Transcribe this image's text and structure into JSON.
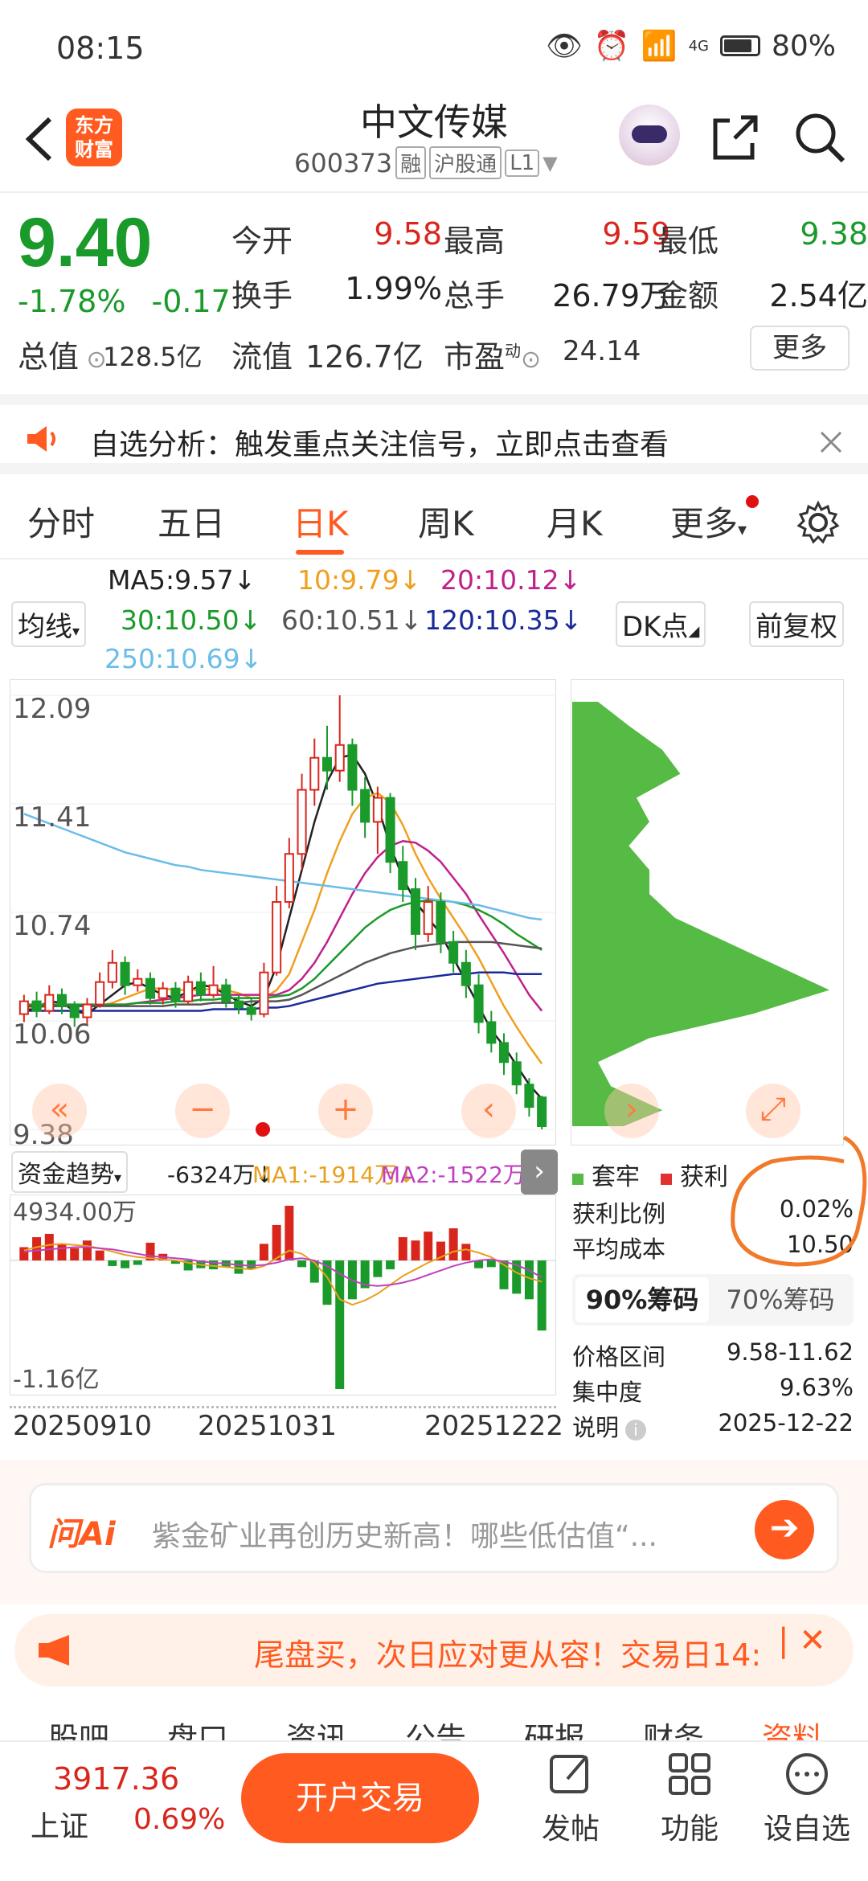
{
  "status": {
    "time": "08:15",
    "network": "4G",
    "battery": "80%"
  },
  "header": {
    "logo": "东方财富",
    "name": "中文传媒",
    "code": "600373",
    "tags": [
      "融",
      "沪股通",
      "L1"
    ]
  },
  "quote": {
    "price": "9.40",
    "change_pct": "-1.78%",
    "change": "-0.17",
    "rows": [
      [
        {
          "label": "今开",
          "value": "9.58",
          "color": "red"
        },
        {
          "label": "最高",
          "value": "9.59",
          "color": "red"
        },
        {
          "label": "最低",
          "value": "9.38",
          "color": "green"
        }
      ],
      [
        {
          "label": "换手",
          "value": "1.99%",
          "color": "dark"
        },
        {
          "label": "总手",
          "value": "26.79万",
          "color": "dark"
        },
        {
          "label": "金额",
          "value": "2.54亿",
          "color": "dark"
        }
      ]
    ],
    "total_value_label": "总值",
    "total_value": "128.5亿",
    "float_label": "流值",
    "float_value": "126.7亿",
    "pe_label": "市盈",
    "pe_sup": "动",
    "pe_value": "24.14",
    "more": "更多"
  },
  "notice": {
    "text": "自选分析：触发重点关注信号，立即点击查看"
  },
  "tabs": {
    "items": [
      "分时",
      "五日",
      "日K",
      "周K",
      "月K",
      "更多"
    ],
    "active": "日K"
  },
  "ma": {
    "selector": "均线",
    "ma5": "MA5:9.57↓",
    "ma10": "10:9.79↓",
    "ma20": "20:10.12↓",
    "ma30": "30:10.50↓",
    "ma60": "60:10.51↓",
    "ma120": "120:10.35↓",
    "ma250": "250:10.69↓",
    "dk": "DK点",
    "adjust": "前复权",
    "colors": {
      "ma5": "#222222",
      "ma10": "#f0a020",
      "ma20": "#c0208a",
      "ma30": "#1a9a2a",
      "ma60": "#555555",
      "ma120": "#1a2a9a",
      "ma250": "#6bbde8"
    }
  },
  "chart_data": [
    {
      "type": "candlestick",
      "y_ticks": [
        "12.09",
        "11.41",
        "10.74",
        "10.06",
        "9.38"
      ],
      "ylim": [
        9.38,
        12.09
      ],
      "ma_lines": {
        "ma5": [
          10.12,
          10.14,
          10.18,
          10.17,
          10.12,
          10.1,
          10.16,
          10.22,
          10.28,
          10.3,
          10.26,
          10.22,
          10.2,
          10.24,
          10.28,
          10.27,
          10.22,
          10.18,
          10.15,
          10.2,
          10.4,
          10.7,
          11.0,
          11.3,
          11.55,
          11.7,
          11.72,
          11.6,
          11.4,
          11.15,
          10.95,
          10.8,
          10.7,
          10.6,
          10.45,
          10.3,
          10.15,
          10.0,
          9.9,
          9.78,
          9.66,
          9.57
        ],
        "ma10": [
          10.14,
          10.14,
          10.15,
          10.16,
          10.16,
          10.15,
          10.15,
          10.17,
          10.2,
          10.23,
          10.26,
          10.26,
          10.25,
          10.25,
          10.25,
          10.26,
          10.25,
          10.23,
          10.2,
          10.2,
          10.25,
          10.35,
          10.55,
          10.75,
          10.98,
          11.18,
          11.35,
          11.45,
          11.48,
          11.42,
          11.28,
          11.1,
          10.95,
          10.82,
          10.7,
          10.58,
          10.45,
          10.3,
          10.15,
          10.02,
          9.9,
          9.79
        ],
        "ma20": [
          10.15,
          10.15,
          10.15,
          10.15,
          10.15,
          10.15,
          10.15,
          10.16,
          10.16,
          10.17,
          10.18,
          10.19,
          10.2,
          10.21,
          10.22,
          10.22,
          10.22,
          10.22,
          10.22,
          10.22,
          10.22,
          10.25,
          10.32,
          10.42,
          10.55,
          10.7,
          10.85,
          10.98,
          11.08,
          11.15,
          11.18,
          11.17,
          11.12,
          11.05,
          10.95,
          10.85,
          10.72,
          10.6,
          10.48,
          10.35,
          10.22,
          10.12
        ],
        "ma30": [
          10.16,
          10.16,
          10.16,
          10.16,
          10.16,
          10.16,
          10.16,
          10.16,
          10.16,
          10.17,
          10.17,
          10.17,
          10.18,
          10.18,
          10.19,
          10.19,
          10.2,
          10.2,
          10.2,
          10.2,
          10.21,
          10.22,
          10.26,
          10.32,
          10.4,
          10.48,
          10.56,
          10.64,
          10.7,
          10.75,
          10.78,
          10.8,
          10.81,
          10.81,
          10.8,
          10.78,
          10.75,
          10.71,
          10.66,
          10.6,
          10.55,
          10.5
        ],
        "ma60": [
          10.15,
          10.15,
          10.15,
          10.15,
          10.15,
          10.15,
          10.15,
          10.15,
          10.15,
          10.15,
          10.15,
          10.15,
          10.16,
          10.16,
          10.16,
          10.17,
          10.17,
          10.17,
          10.18,
          10.18,
          10.18,
          10.19,
          10.22,
          10.26,
          10.3,
          10.34,
          10.38,
          10.42,
          10.45,
          10.48,
          10.5,
          10.52,
          10.53,
          10.54,
          10.55,
          10.55,
          10.55,
          10.55,
          10.54,
          10.53,
          10.52,
          10.51
        ],
        "ma120": [
          10.12,
          10.12,
          10.12,
          10.12,
          10.12,
          10.12,
          10.12,
          10.12,
          10.12,
          10.12,
          10.12,
          10.12,
          10.12,
          10.12,
          10.12,
          10.13,
          10.13,
          10.13,
          10.13,
          10.14,
          10.14,
          10.15,
          10.17,
          10.19,
          10.21,
          10.23,
          10.25,
          10.27,
          10.29,
          10.3,
          10.31,
          10.32,
          10.33,
          10.34,
          10.35,
          10.35,
          10.36,
          10.36,
          10.36,
          10.35,
          10.35,
          10.35
        ],
        "ma250": [
          11.35,
          11.32,
          11.29,
          11.26,
          11.23,
          11.2,
          11.17,
          11.14,
          11.11,
          11.09,
          11.07,
          11.05,
          11.03,
          11.02,
          11.0,
          10.99,
          10.98,
          10.97,
          10.96,
          10.95,
          10.94,
          10.93,
          10.92,
          10.91,
          10.9,
          10.89,
          10.88,
          10.87,
          10.86,
          10.85,
          10.84,
          10.83,
          10.82,
          10.81,
          10.8,
          10.79,
          10.78,
          10.76,
          10.74,
          10.72,
          10.7,
          10.69
        ]
      },
      "candles": [
        [
          10.1,
          10.18,
          10.22,
          10.05
        ],
        [
          10.18,
          10.12,
          10.24,
          10.08
        ],
        [
          10.12,
          10.22,
          10.28,
          10.1
        ],
        [
          10.22,
          10.15,
          10.26,
          10.1
        ],
        [
          10.15,
          10.08,
          10.18,
          10.02
        ],
        [
          10.08,
          10.16,
          10.2,
          10.04
        ],
        [
          10.16,
          10.3,
          10.36,
          10.14
        ],
        [
          10.3,
          10.42,
          10.5,
          10.26
        ],
        [
          10.42,
          10.28,
          10.46,
          10.22
        ],
        [
          10.28,
          10.32,
          10.38,
          10.24
        ],
        [
          10.32,
          10.2,
          10.36,
          10.16
        ],
        [
          10.2,
          10.26,
          10.3,
          10.16
        ],
        [
          10.26,
          10.18,
          10.3,
          10.14
        ],
        [
          10.18,
          10.3,
          10.34,
          10.16
        ],
        [
          10.3,
          10.22,
          10.36,
          10.18
        ],
        [
          10.22,
          10.28,
          10.4,
          10.2
        ],
        [
          10.28,
          10.18,
          10.32,
          10.14
        ],
        [
          10.18,
          10.14,
          10.22,
          10.1
        ],
        [
          10.14,
          10.1,
          10.2,
          10.06
        ],
        [
          10.1,
          10.36,
          10.42,
          10.08
        ],
        [
          10.36,
          10.8,
          10.9,
          10.34
        ],
        [
          10.8,
          11.1,
          11.2,
          10.76
        ],
        [
          11.1,
          11.5,
          11.6,
          11.0
        ],
        [
          11.5,
          11.7,
          11.82,
          11.4
        ],
        [
          11.7,
          11.62,
          11.9,
          11.5
        ],
        [
          11.62,
          11.78,
          12.09,
          11.55
        ],
        [
          11.78,
          11.5,
          11.82,
          11.4
        ],
        [
          11.5,
          11.3,
          11.58,
          11.2
        ],
        [
          11.3,
          11.45,
          11.52,
          11.1
        ],
        [
          11.45,
          11.05,
          11.48,
          10.98
        ],
        [
          11.05,
          10.88,
          11.15,
          10.8
        ],
        [
          10.88,
          10.6,
          10.95,
          10.5
        ],
        [
          10.6,
          10.8,
          10.9,
          10.55
        ],
        [
          10.8,
          10.55,
          10.86,
          10.48
        ],
        [
          10.55,
          10.42,
          10.62,
          10.36
        ],
        [
          10.42,
          10.28,
          10.5,
          10.2
        ],
        [
          10.28,
          10.05,
          10.35,
          9.98
        ],
        [
          10.05,
          9.92,
          10.12,
          9.86
        ],
        [
          9.92,
          9.8,
          9.98,
          9.72
        ],
        [
          9.8,
          9.66,
          9.86,
          9.6
        ],
        [
          9.66,
          9.52,
          9.7,
          9.46
        ],
        [
          9.58,
          9.4,
          9.59,
          9.38
        ]
      ]
    },
    {
      "type": "bar",
      "title": "资金趋势",
      "y_ticks": [
        "4934.00万",
        "-1.16亿"
      ],
      "x_ticks": [
        "20250910",
        "20251031",
        "20251222"
      ],
      "ylim": [
        -11600,
        4934
      ],
      "values": [
        1200,
        2100,
        2400,
        1500,
        1100,
        1800,
        900,
        -500,
        -700,
        -400,
        1600,
        600,
        -300,
        -900,
        -700,
        -800,
        -600,
        -1200,
        -800,
        1500,
        3200,
        4934,
        -600,
        -2000,
        -4000,
        -11600,
        -3500,
        -2500,
        -1500,
        -800,
        2100,
        1800,
        2600,
        1700,
        2900,
        1500,
        -700,
        -600,
        -2600,
        -3000,
        -3500,
        -6324
      ],
      "ma1": [
        900,
        1200,
        1400,
        1500,
        1400,
        1300,
        1100,
        800,
        500,
        300,
        200,
        100,
        0,
        -200,
        -400,
        -500,
        -600,
        -700,
        -800,
        -500,
        200,
        900,
        600,
        -200,
        -1500,
        -3500,
        -4000,
        -3600,
        -3000,
        -2200,
        -1400,
        -800,
        -200,
        300,
        800,
        1000,
        700,
        300,
        -400,
        -1100,
        -1600,
        -1914
      ],
      "ma2": [
        800,
        900,
        1000,
        1100,
        1200,
        1200,
        1100,
        1000,
        800,
        600,
        400,
        300,
        200,
        100,
        -100,
        -200,
        -300,
        -400,
        -500,
        -400,
        -200,
        100,
        200,
        0,
        -500,
        -1200,
        -1800,
        -2200,
        -2300,
        -2200,
        -2000,
        -1700,
        -1300,
        -900,
        -500,
        -200,
        0,
        100,
        -100,
        -400,
        -900,
        -1522
      ]
    },
    {
      "type": "area",
      "title": "筹码分布",
      "ylim": [
        9.38,
        12.09
      ],
      "prices": [
        12.05,
        11.9,
        11.75,
        11.6,
        11.45,
        11.3,
        11.15,
        11.0,
        10.85,
        10.7,
        10.55,
        10.4,
        10.25,
        10.1,
        9.95,
        9.8,
        9.65,
        9.5,
        9.4
      ],
      "values": [
        0.1,
        0.22,
        0.35,
        0.42,
        0.25,
        0.3,
        0.22,
        0.3,
        0.3,
        0.4,
        0.6,
        0.8,
        1.0,
        0.7,
        0.3,
        0.1,
        0.15,
        0.35,
        0.2
      ]
    }
  ],
  "flow": {
    "title": "资金趋势",
    "val": "-6324万↓",
    "ma1": "MA1:-1914万↓",
    "ma2": "MA2:-1522万↓"
  },
  "chip": {
    "legend_lock": "套牢",
    "legend_profit": "获利",
    "profit_ratio_label": "获利比例",
    "profit_ratio": "0.02%",
    "avg_cost_label": "平均成本",
    "avg_cost": "10.50",
    "tab_90": "90%筹码",
    "tab_70": "70%筹码",
    "range_label": "价格区间",
    "range": "9.58-11.62",
    "conc_label": "集中度",
    "conc": "9.63%",
    "note_label": "说明",
    "note_date": "2025-12-22"
  },
  "ai": {
    "brand": "问Ai",
    "placeholder": "紫金矿业再创历史新高！哪些低估值“..."
  },
  "promo": {
    "text": "尾盘买，次日应对更从容！交易日14:"
  },
  "subtabs": [
    "股吧",
    "盘口",
    "资讯",
    "公告",
    "研报",
    "财务",
    "资料"
  ],
  "bottom": {
    "index_value": "3917.36",
    "index_name": "上证",
    "index_pct": "0.69%",
    "trade": "开户交易",
    "post": "发帖",
    "func": "功能",
    "watch": "设自选"
  }
}
